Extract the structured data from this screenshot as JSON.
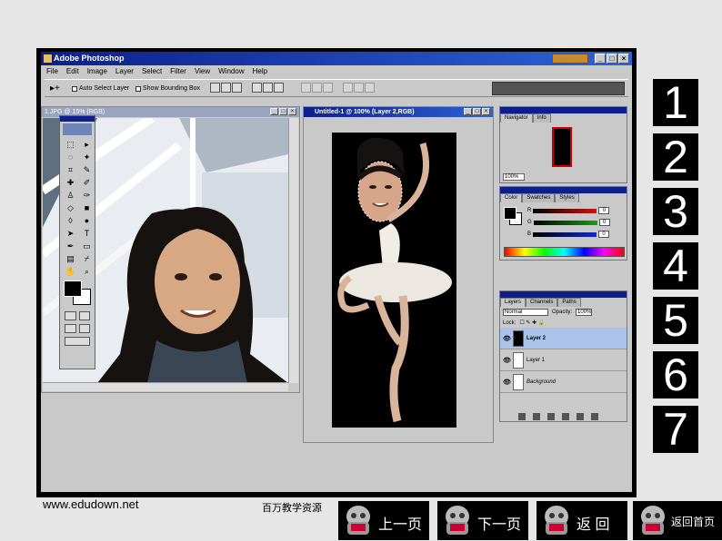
{
  "window": {
    "title": "Adobe Photoshop",
    "buttons": [
      "_",
      "□",
      "×"
    ]
  },
  "menu": [
    "File",
    "Edit",
    "Image",
    "Layer",
    "Select",
    "Filter",
    "View",
    "Window",
    "Help"
  ],
  "options": {
    "auto_select": "Auto Select Layer",
    "show_bounding": "Show Bounding Box"
  },
  "doc1": {
    "title": "1.JPG @ 15% (RGB)"
  },
  "doc2": {
    "title": "Untitled-1 @ 100% (Layer 2,RGB)"
  },
  "navigator": {
    "tabs": [
      "Navigator",
      "Info"
    ],
    "zoom": "100%"
  },
  "color_palette": {
    "tabs": [
      "Color",
      "Swatches",
      "Styles"
    ],
    "channels": [
      {
        "label": "R",
        "value": "0",
        "color": "#c81414"
      },
      {
        "label": "G",
        "value": "0",
        "color": "#14a014"
      },
      {
        "label": "B",
        "value": "0",
        "color": "#1428c8"
      }
    ]
  },
  "layers_palette": {
    "tabs": [
      "Layers",
      "Channels",
      "Paths"
    ],
    "blend_mode": "Normal",
    "opacity_label": "Opacity:",
    "opacity_value": "100%",
    "lock_label": "Lock:",
    "layers": [
      {
        "name": "Layer 2",
        "active": true
      },
      {
        "name": "Layer 1",
        "active": false
      },
      {
        "name": "Background",
        "active": false
      }
    ]
  },
  "steps": [
    "1",
    "2",
    "3",
    "4",
    "5",
    "6",
    "7"
  ],
  "footer": {
    "site": "www.edudown.net",
    "resource_text": "百万教学资源",
    "buttons": [
      "上一页",
      "下一页",
      "返 回",
      "返回首页"
    ]
  },
  "colors": {
    "titlebar": "#0c1f8c",
    "frame": "#000000",
    "panel": "#c9c9c9"
  }
}
